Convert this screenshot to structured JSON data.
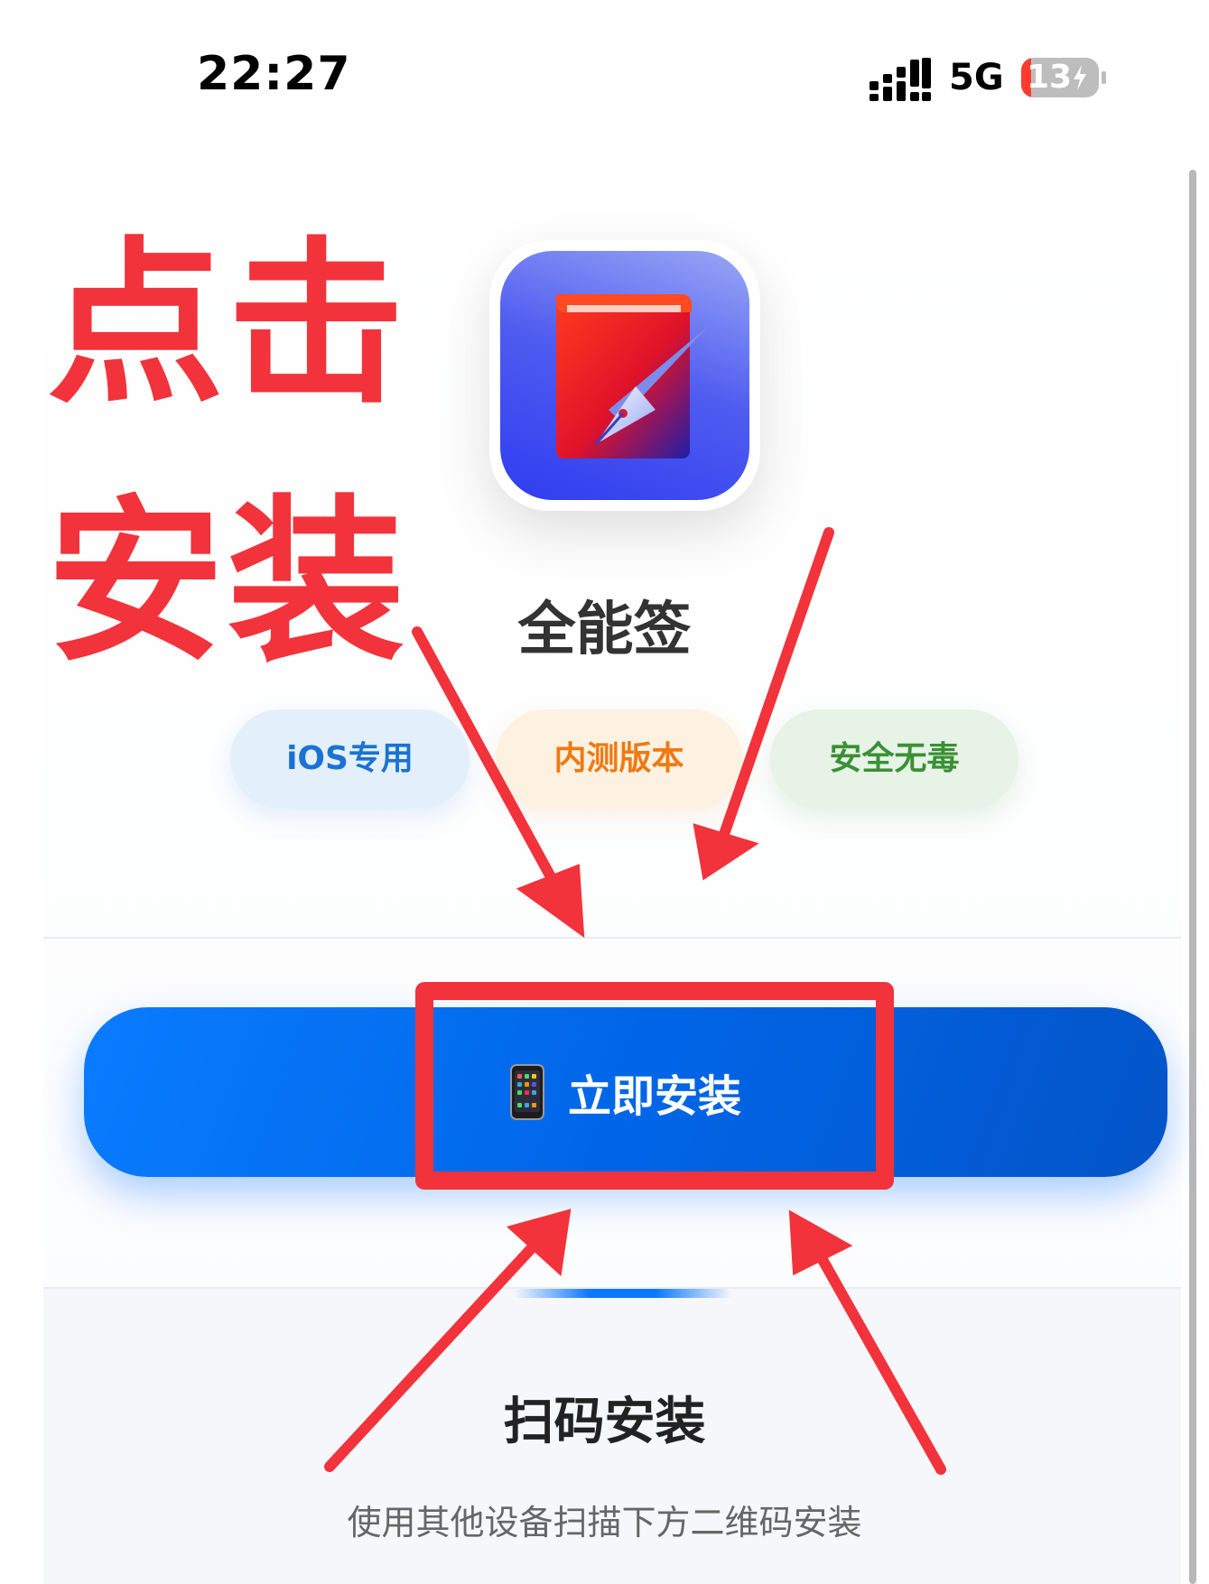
{
  "status_bar": {
    "time": "22:27",
    "network": "5G",
    "battery_level": "13",
    "battery_fraction": 0.13,
    "charging": true,
    "signal_icon": "cellular-signal-icon"
  },
  "app": {
    "name": "全能签",
    "icon": "book-pen-app-icon"
  },
  "tags": [
    {
      "label": "iOS专用",
      "color": "#1b72d2"
    },
    {
      "label": "内测版本",
      "color": "#ee7a12"
    },
    {
      "label": "安全无毒",
      "color": "#3a9035"
    }
  ],
  "install_button": {
    "icon": "mobile-phone-icon",
    "label": "立即安装"
  },
  "qr_section": {
    "title": "扫码安装",
    "subtitle": "使用其他设备扫描下方二维码安装"
  },
  "annotation": {
    "line1": "点击",
    "line2": "安装",
    "color": "#f2333b"
  }
}
